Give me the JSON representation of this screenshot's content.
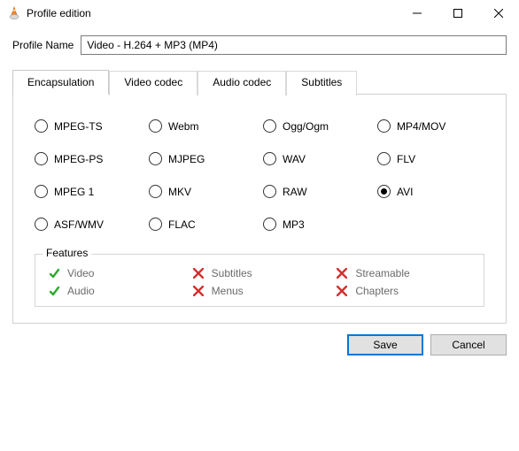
{
  "window": {
    "title": "Profile edition"
  },
  "profile": {
    "label": "Profile Name",
    "value": "Video - H.264 + MP3 (MP4)"
  },
  "tabs": [
    {
      "label": "Encapsulation"
    },
    {
      "label": "Video codec"
    },
    {
      "label": "Audio codec"
    },
    {
      "label": "Subtitles"
    }
  ],
  "active_tab": 0,
  "encapsulation": {
    "selected": "AVI",
    "options": [
      "MPEG-TS",
      "Webm",
      "Ogg/Ogm",
      "MP4/MOV",
      "MPEG-PS",
      "MJPEG",
      "WAV",
      "FLV",
      "MPEG 1",
      "MKV",
      "RAW",
      "AVI",
      "ASF/WMV",
      "FLAC",
      "MP3"
    ]
  },
  "features": {
    "legend": "Features",
    "items": [
      {
        "label": "Video",
        "ok": true
      },
      {
        "label": "Subtitles",
        "ok": false
      },
      {
        "label": "Streamable",
        "ok": false
      },
      {
        "label": "Audio",
        "ok": true
      },
      {
        "label": "Menus",
        "ok": false
      },
      {
        "label": "Chapters",
        "ok": false
      }
    ]
  },
  "buttons": {
    "save": "Save",
    "cancel": "Cancel"
  }
}
